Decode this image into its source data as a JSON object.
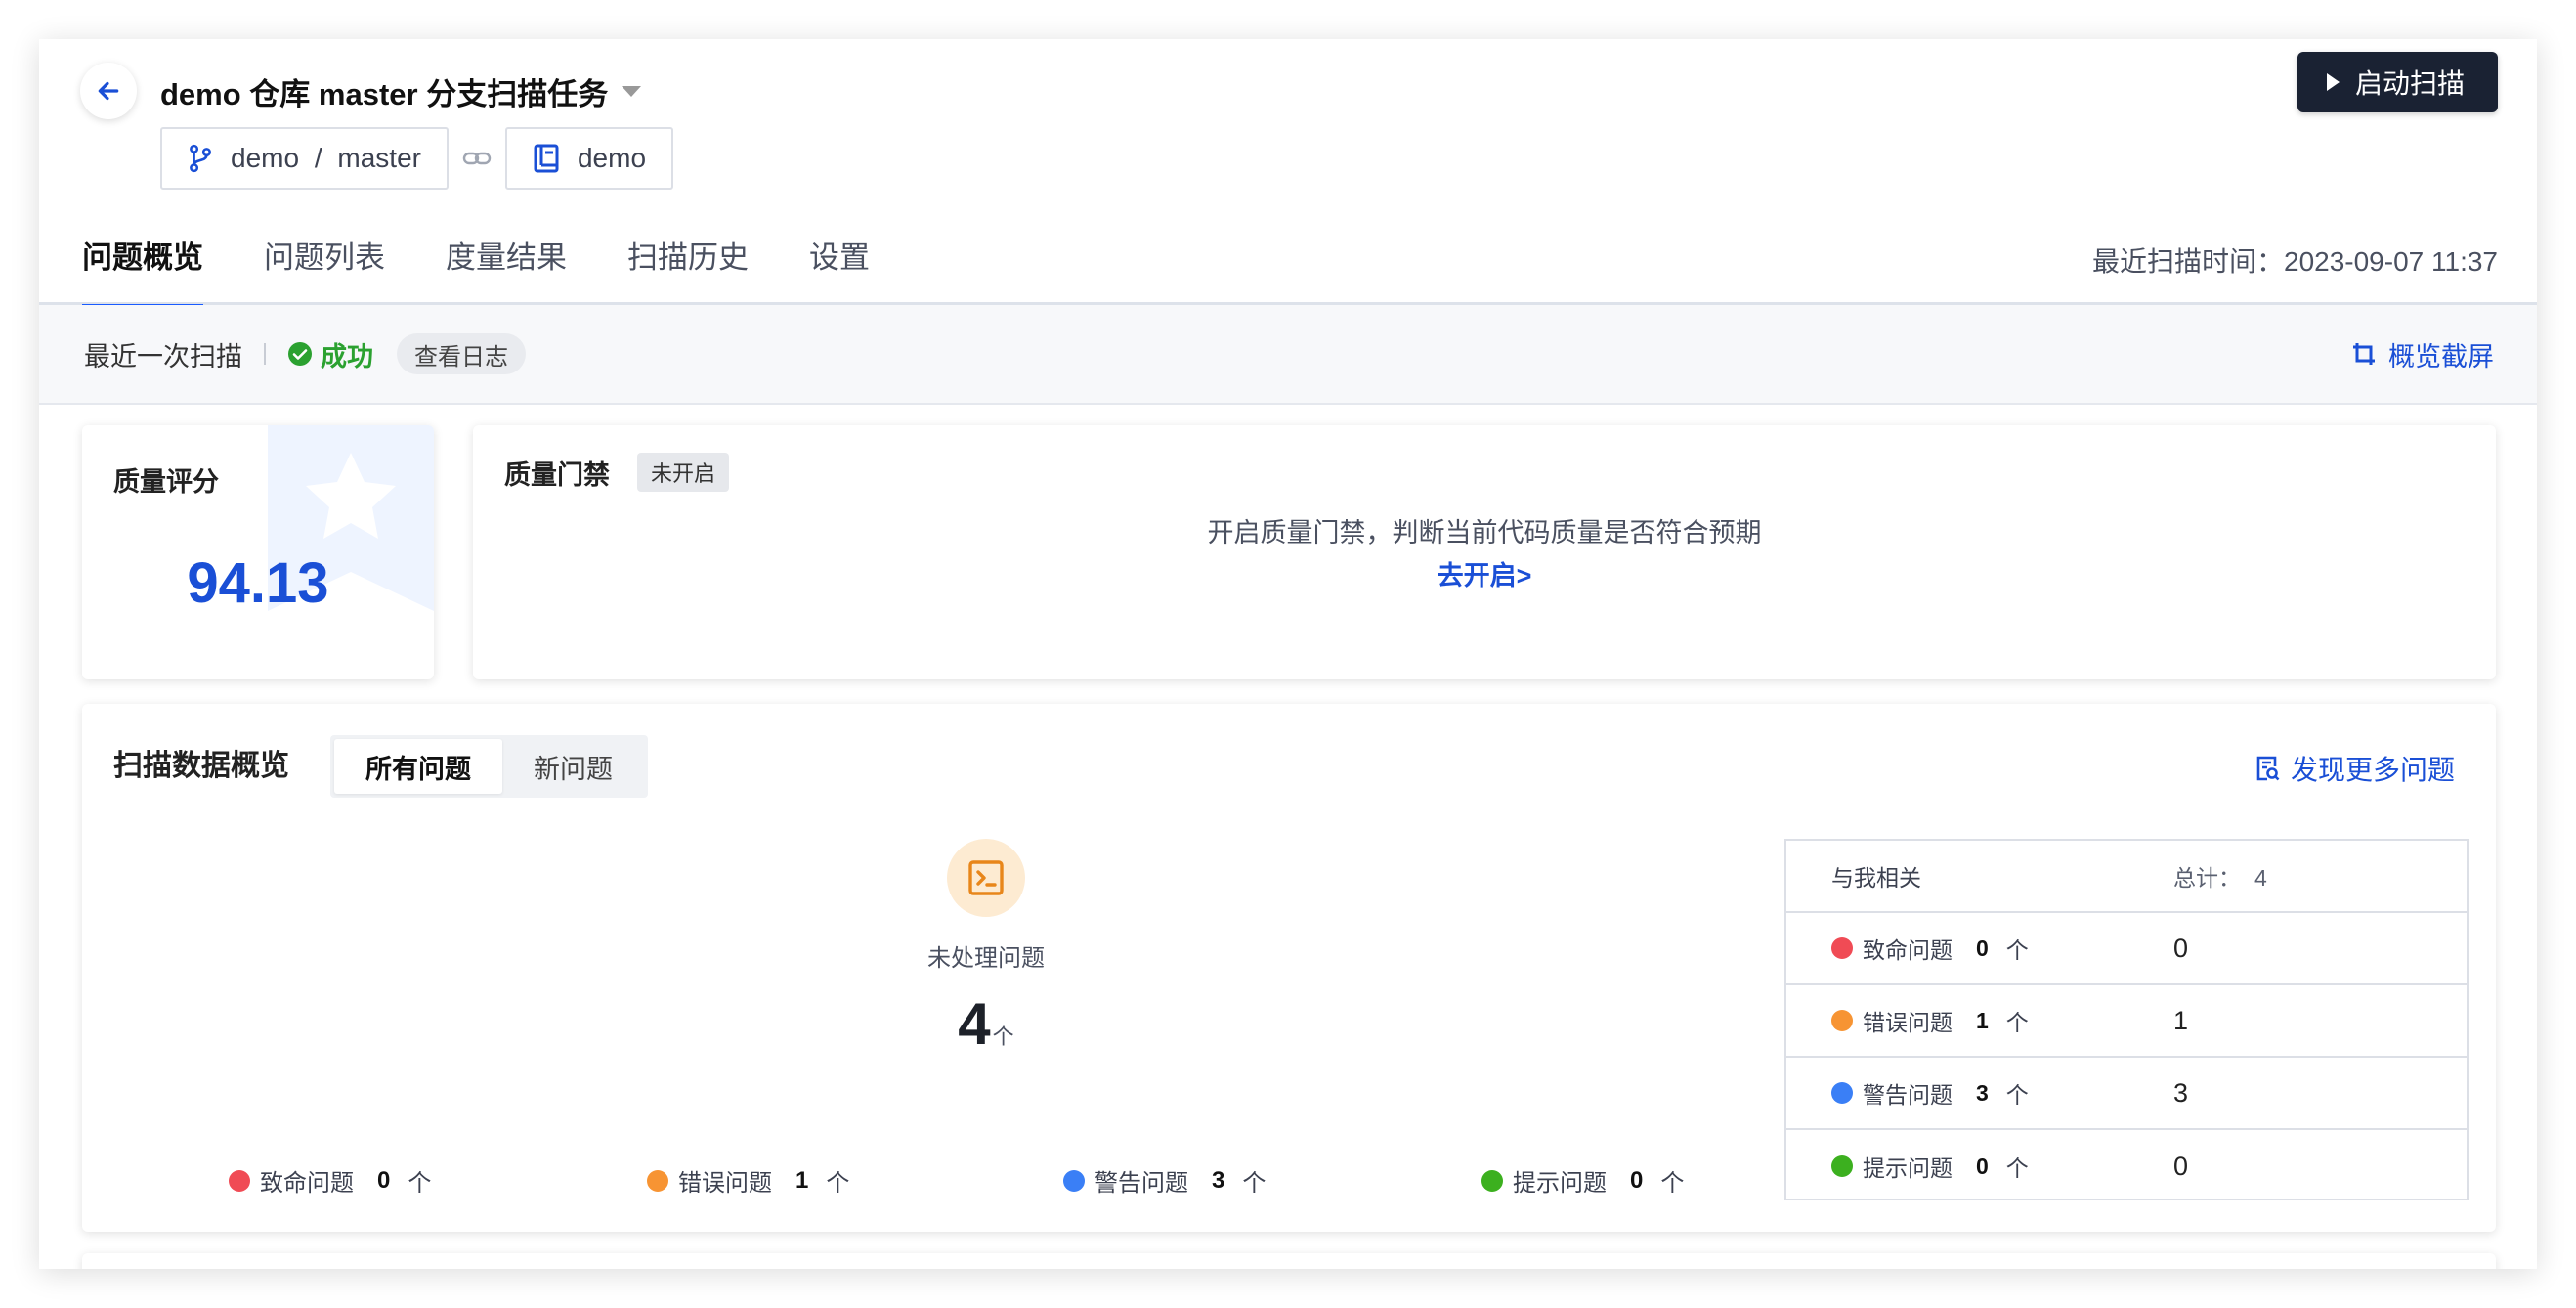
{
  "header": {
    "title": "demo 仓库 master 分支扫描任务",
    "start_button": "启动扫描",
    "branch_chip": {
      "repo": "demo",
      "sep": "/",
      "branch": "master"
    },
    "project_chip": "demo",
    "tabs": [
      {
        "label": "问题概览",
        "active": true
      },
      {
        "label": "问题列表",
        "active": false
      },
      {
        "label": "度量结果",
        "active": false
      },
      {
        "label": "扫描历史",
        "active": false
      },
      {
        "label": "设置",
        "active": false
      }
    ],
    "last_scan": "最近扫描时间：2023-09-07 11:37"
  },
  "status_bar": {
    "label": "最近一次扫描",
    "status": "成功",
    "log_button": "查看日志",
    "screenshot_link": "概览截屏"
  },
  "score_card": {
    "title": "质量评分",
    "value": "94.13"
  },
  "gate_card": {
    "title": "质量门禁",
    "badge": "未开启",
    "description": "开启质量门禁，判断当前代码质量是否符合预期",
    "link": "去开启>"
  },
  "overview": {
    "title": "扫描数据概览",
    "segments": [
      {
        "label": "所有问题",
        "active": true
      },
      {
        "label": "新问题",
        "active": false
      }
    ],
    "more_link": "发现更多问题",
    "unresolved_label": "未处理问题",
    "unresolved_count": "4",
    "unresolved_unit": "个",
    "legend": [
      {
        "label": "致命问题",
        "count": "0",
        "unit": "个",
        "color": "#f04b55"
      },
      {
        "label": "错误问题",
        "count": "1",
        "unit": "个",
        "color": "#f79433"
      },
      {
        "label": "警告问题",
        "count": "3",
        "unit": "个",
        "color": "#3a7ff6"
      },
      {
        "label": "提示问题",
        "count": "0",
        "unit": "个",
        "color": "#3cb01f"
      }
    ],
    "table": {
      "header_col1": "与我相关",
      "header_col2": "总计：",
      "total": "4",
      "rows": [
        {
          "label": "致命问题",
          "count": "0",
          "unit": "个",
          "value": "0",
          "color": "#f04b55"
        },
        {
          "label": "错误问题",
          "count": "1",
          "unit": "个",
          "value": "1",
          "color": "#f79433"
        },
        {
          "label": "警告问题",
          "count": "3",
          "unit": "个",
          "value": "3",
          "color": "#3a7ff6"
        },
        {
          "label": "提示问题",
          "count": "0",
          "unit": "个",
          "value": "0",
          "color": "#3cb01f"
        }
      ]
    }
  },
  "colors": {
    "accent": "#1a4fd6",
    "tab_underline": "#1a5cff",
    "success": "#2ba130",
    "dark_button": "#1a2233"
  },
  "icons": [
    "back-arrow-icon",
    "dropdown-caret-icon",
    "play-icon",
    "git-branch-icon",
    "link-icon",
    "project-book-icon",
    "success-check-icon",
    "crop-icon",
    "star-icon",
    "terminal-icon",
    "search-doc-icon"
  ]
}
